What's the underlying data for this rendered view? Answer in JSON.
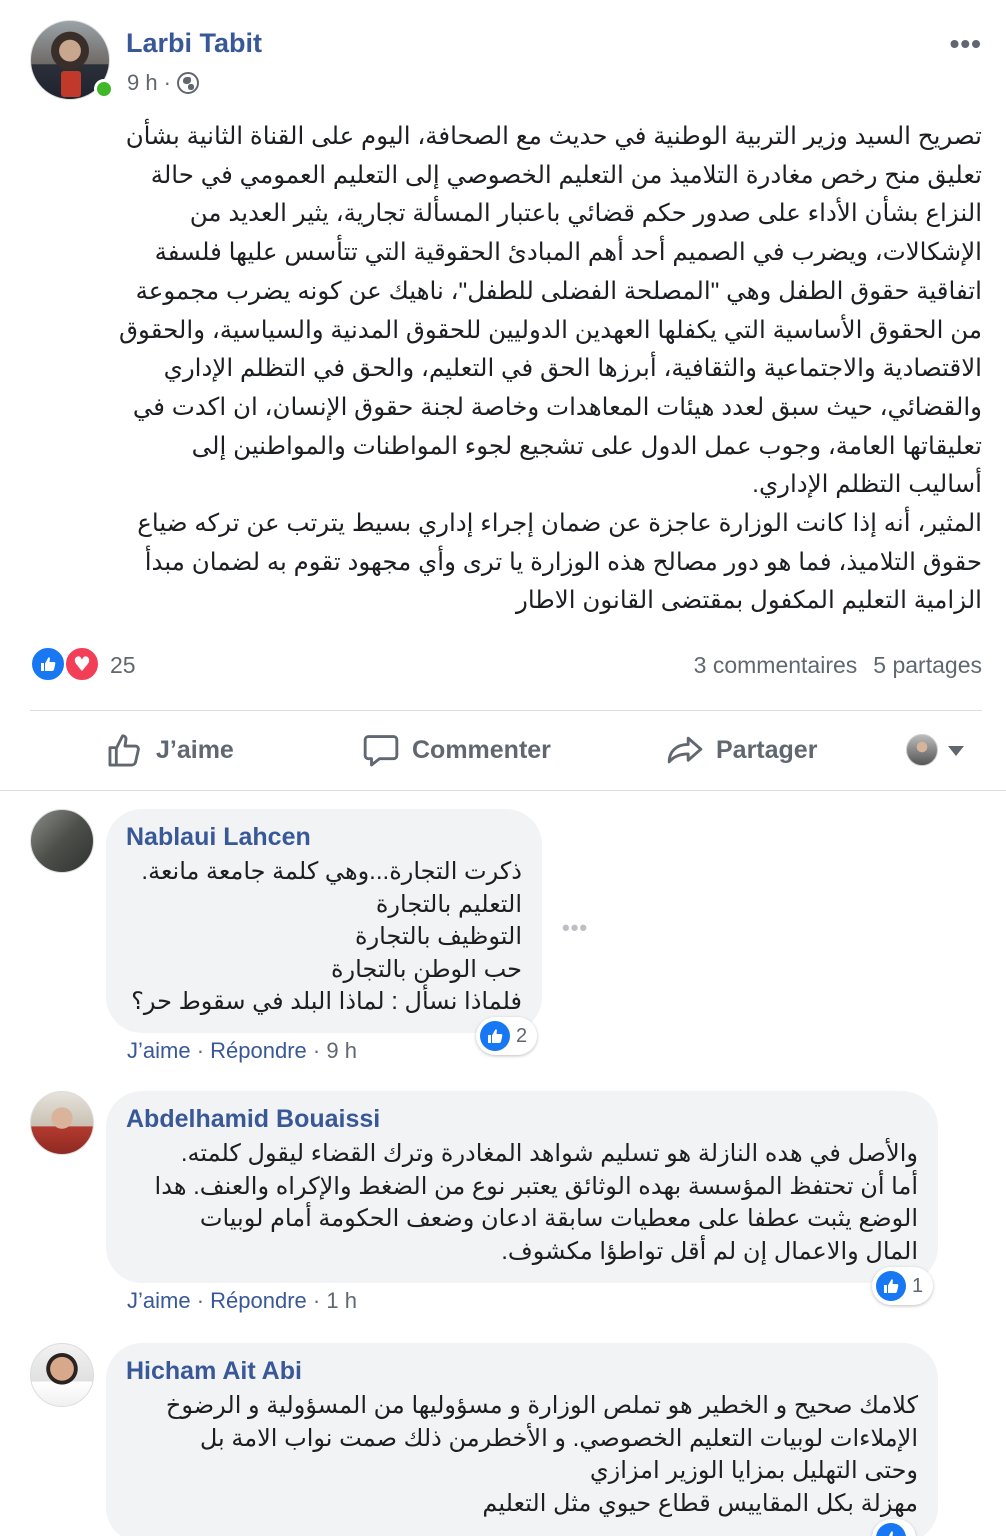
{
  "post": {
    "author": "Larbi Tabit",
    "time": "9 h",
    "separator": "·",
    "more_label": "•••",
    "text_lines": [
      "تصريح السيد وزير التربية الوطنية في حديث مع الصحافة، اليوم على القناة الثانية بشأن",
      "تعليق منح رخص مغادرة التلاميذ من التعليم الخصوصي إلى التعليم العمومي في حالة",
      "النزاع بشأن الأداء على صدور حكم قضائي باعتبار المسألة تجارية، يثير العديد من",
      "الإشكالات، ويضرب في الصميم أحد أهم المبادئ الحقوقية التي تتأسس عليها فلسفة",
      "اتفاقية حقوق الطفل وهي \"المصلحة الفضلى للطفل\"، ناهيك عن كونه يضرب مجموعة",
      "من الحقوق الأساسية التي يكفلها العهدين الدوليين للحقوق المدنية والسياسية، والحقوق",
      "الاقتصادية والاجتماعية والثقافية، أبرزها الحق في التعليم، والحق في التظلم الإداري",
      "والقضائي، حيث سبق لعدد هيئات المعاهدات وخاصة لجنة حقوق الإنسان، ان اكدت في",
      "تعليقاتها العامة، وجوب عمل الدول على تشجيع لجوء المواطنات والمواطنين إلى",
      "أساليب التظلم الإداري.",
      "المثير، أنه إذا كانت الوزارة عاجزة عن ضمان إجراء إداري بسيط يترتب عن تركه ضياع",
      "حقوق التلاميذ، فما هو دور مصالح هذه الوزارة يا ترى وأي مجهود تقوم به لضمان مبدأ",
      "الزامية التعليم المكفول بمقتضى القانون الاطار"
    ],
    "reactions_count": "25",
    "comments_count": "3 commentaires",
    "shares_count": "5 partages",
    "actions": {
      "like": "J’aime",
      "comment": "Commenter",
      "share": "Partager"
    },
    "colors": {
      "link": "#385898",
      "like_blue": "#1877f2",
      "love_red": "#f33e58",
      "online_green": "#42b72a"
    }
  },
  "comments": [
    {
      "name": "Nablaui Lahcen",
      "lines": [
        "ذكرت التجارة...وهي كلمة جامعة مانعة.",
        "التعليم بالتجارة",
        "التوظيف بالتجارة",
        "حب الوطن بالتجارة",
        "فلماذا نسأل : لماذا البلد في سقوط حر؟"
      ],
      "like_label": "J’aime",
      "reply_label": "Répondre",
      "time": "9 h",
      "likes": "2",
      "more_label": "•••"
    },
    {
      "name": "Abdelhamid Bouaissi",
      "lines": [
        "والأصل في هده النازلة هو تسليم شواهد المغادرة وترك القضاء ليقول كلمته.",
        "أما أن تحتفظ المؤسسة بهده الوثائق يعتبر نوع من الضغط والإكراه والعنف. هدا",
        "الوضع يثبت عطفا على معطيات سابقة ادعان وضعف الحكومة أمام لوبيات",
        "المال والاعمال إن لم أقل تواطؤا مكشوف."
      ],
      "like_label": "J’aime",
      "reply_label": "Répondre",
      "time": "1 h",
      "likes": "1"
    },
    {
      "name": "Hicham Ait Abi",
      "lines": [
        "كلامك صحيح و الخطير هو تملص الوزارة و مسؤوليها من المسؤولية و الرضوخ",
        "الإملاءات لوبيات التعليم الخصوصي. و الأخطرمن ذلك صمت نواب الامة بل",
        "وحتى التهليل بمزايا الوزير امزازي",
        "مهزلة بكل المقاييس قطاع حيوي مثل التعليم"
      ]
    }
  ],
  "icons": {
    "globe": "globe-icon",
    "like": "thumbs-up-icon",
    "love": "heart-icon",
    "comment": "speech-bubble-icon",
    "share": "share-arrow-icon",
    "more": "more-horizontal-icon",
    "caret": "caret-down-icon"
  }
}
